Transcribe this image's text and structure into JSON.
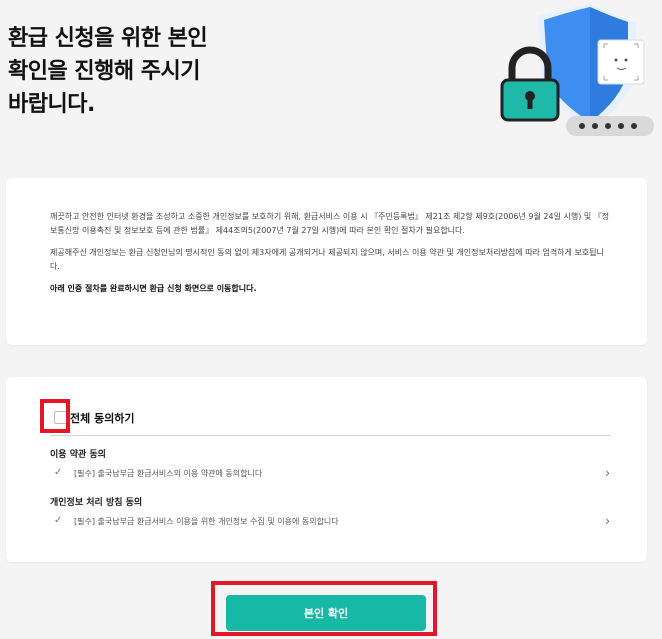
{
  "header": {
    "title_lines": [
      "환급 신청을 위한 본인",
      "확인을 진행해 주시기",
      "바랍니다."
    ]
  },
  "illustration": {
    "icons": [
      "shield-icon",
      "lock-icon",
      "face-scan-icon",
      "password-dots-icon"
    ],
    "password_dots": "● ● ● ● ●"
  },
  "notice": {
    "paragraphs": [
      "깨끗하고 안전한 인터넷 환경을 조성하고 소중한 개인정보를 보호하기 위해, 환급서비스 이용 시 『주민등록법』 제21조 제2항 제9호(2006년 9월 24일 시행) 및 『정보통신망 이용촉진 및 정보보호 등에 관한 법률』 제44조의5(2007년 7월 27일 시행)에 따라 본인 확인 절차가 필요합니다.",
      "제공해주신 개인정보는 환급 신청인님의 명시적인 동의 없이 제3자에게 공개되거나 제공되지 않으며, 서비스 이용 약관 및 개인정보처리방침에 따라 엄격하게 보호됩니다.",
      "아래 인증 절차를 완료하시면 환급 신청 화면으로 이동합니다."
    ]
  },
  "agreement": {
    "all_label": "전체 동의하기",
    "terms_title": "이용 약관 동의",
    "terms_item": "[필수] 출국납부금 환급서비스의 이용 약관에 동의합니다",
    "privacy_title": "개인정보 처리 방침 동의",
    "privacy_item": "[필수] 출국납부금 환급서비스 이용을 위한 개인정보 수집 및 이용에 동의합니다",
    "check_glyph": "✓",
    "chevron_glyph": "›"
  },
  "confirm": {
    "label": "본인 확인"
  },
  "colors": {
    "accent": "#17b8a6",
    "highlight": "#e0182a",
    "shield_blue": "#3d8ef0"
  }
}
